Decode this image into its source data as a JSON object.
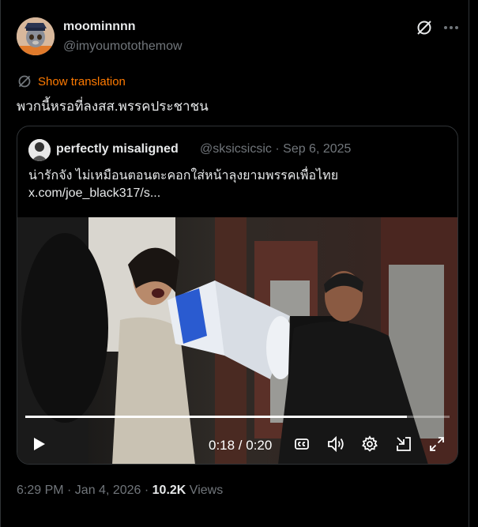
{
  "post": {
    "display_name": "moominnnn",
    "handle": "@imyoumotothemow",
    "show_translation": "Show translation",
    "text": "พวกนี้หรอที่ลงสส.พรรคประชาชน",
    "timestamp": "6:29 PM · Jan 4, 2026 · ",
    "views_count": "10.2K",
    "views_label": " Views"
  },
  "quote": {
    "display_name": "perfectly misaligned",
    "handle": "@sksicsicsic",
    "date": "Sep 6, 2025",
    "text": "น่ารักจัง ไม่เหมือนตอนตะคอกใส่หน้าลุงยามพรรคเพื่อไทย",
    "link": "x.com/joe_black317/s..."
  },
  "video": {
    "time": "0:18 / 0:20",
    "progress_fraction": 0.9
  },
  "colors": {
    "background": "#000000",
    "text": "#e7e9ea",
    "muted": "#71767b",
    "translate": "#ff7a00",
    "border": "#2f3336"
  },
  "icons": [
    "grok-icon",
    "more-icon",
    "translate-icon",
    "play-icon",
    "captions-icon",
    "volume-icon",
    "settings-icon",
    "pip-icon",
    "fullscreen-icon"
  ]
}
